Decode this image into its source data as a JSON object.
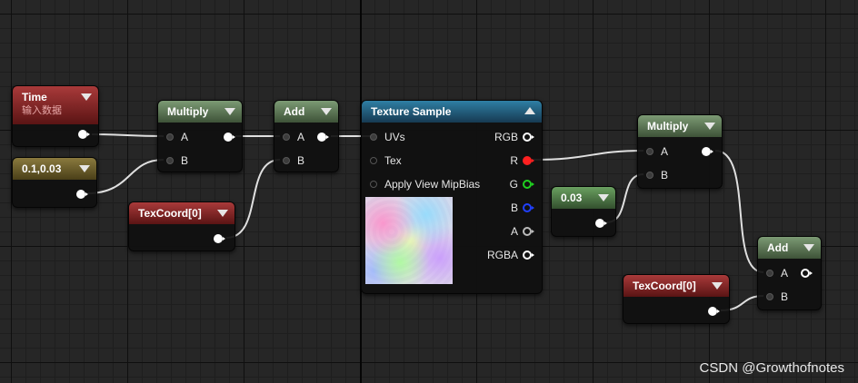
{
  "nodes": {
    "time": {
      "title": "Time",
      "subtitle": "输入数据"
    },
    "constant2": {
      "title": "0.1,0.03"
    },
    "texcoord1": {
      "title": "TexCoord[0]"
    },
    "multiply1": {
      "title": "Multiply",
      "pin_a": "A",
      "pin_b": "B"
    },
    "add1": {
      "title": "Add",
      "pin_a": "A",
      "pin_b": "B"
    },
    "texture_sample": {
      "title": "Texture Sample",
      "inputs": [
        "UVs",
        "Tex",
        "Apply View MipBias"
      ],
      "outputs": [
        "RGB",
        "R",
        "G",
        "B",
        "A",
        "RGBA"
      ]
    },
    "constant1": {
      "title": "0.03"
    },
    "multiply2": {
      "title": "Multiply",
      "pin_a": "A",
      "pin_b": "B"
    },
    "add2": {
      "title": "Add",
      "pin_a": "A",
      "pin_b": "B"
    },
    "texcoord2": {
      "title": "TexCoord[0]"
    }
  },
  "colors": {
    "wire": "#e0e0e0",
    "pin_r": "#ff2020",
    "pin_g": "#20d020",
    "pin_b": "#2040ff",
    "header_green": "#5c7a54",
    "header_red": "#8a2424",
    "header_olive": "#6e6028",
    "header_blue": "#24607e"
  },
  "icons": {
    "collapse": "triangle-down-icon",
    "expand": "triangle-up-icon"
  },
  "watermark": "CSDN @Growthofnotes"
}
